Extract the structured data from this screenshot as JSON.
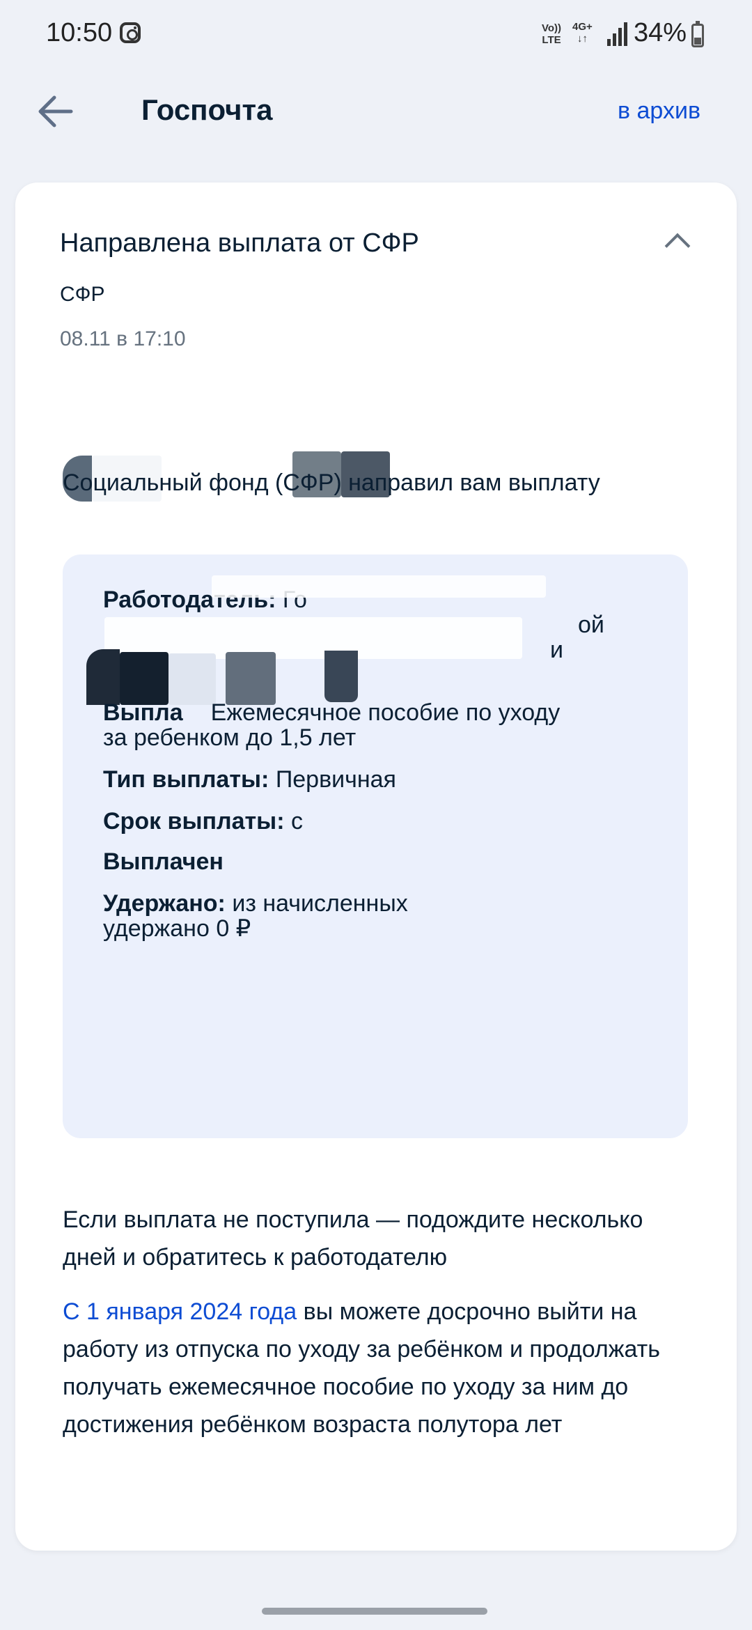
{
  "status_bar": {
    "time": "10:50",
    "volte_top": "Vo))",
    "volte_bottom": "LTE",
    "network_top": "4G+",
    "network_bottom": "↓↑",
    "battery": "34%"
  },
  "header": {
    "title": "Госпочта",
    "archive_label": "в архив"
  },
  "message": {
    "title": "Направлена выплата от СФР",
    "sender": "СФР",
    "date": "08.11 в 17:10",
    "lead": "Социальный фонд (СФР) направил вам выплату",
    "details": {
      "employer_label": "Работодатель:",
      "employer_value": "Го",
      "employer_line2": "ой",
      "employer_line3": "и",
      "payment_label": "Выпла",
      "payment_value": "Ежемесячное пособие по уходу",
      "payment_value2": "за ребенком до 1,5 лет",
      "type_label": "Тип выплаты:",
      "type_value": "Первичная",
      "term_label": "Срок выплаты:",
      "term_value": "с",
      "paid_label": "Выплачен",
      "withheld_label": "Удержано:",
      "withheld_value": "из начисленных",
      "withheld_value2": "удержано 0 ₽"
    },
    "note": "Если выплата не поступила — подождите несколько дней и обратитесь к работодателю",
    "info_link": "С 1 января 2024 года",
    "info_text": "вы можете досрочно выйти на работу из отпуска по уходу за ребёнком и продолжать получать ежемесячное пособие по уходу за ним до достижения ребёнком возраста полутора лет"
  },
  "colors": {
    "accent": "#0d4cd3",
    "text": "#0b1f33",
    "secondary": "#66727f",
    "panel": "#ebf0fc",
    "background": "#eef1f7"
  }
}
